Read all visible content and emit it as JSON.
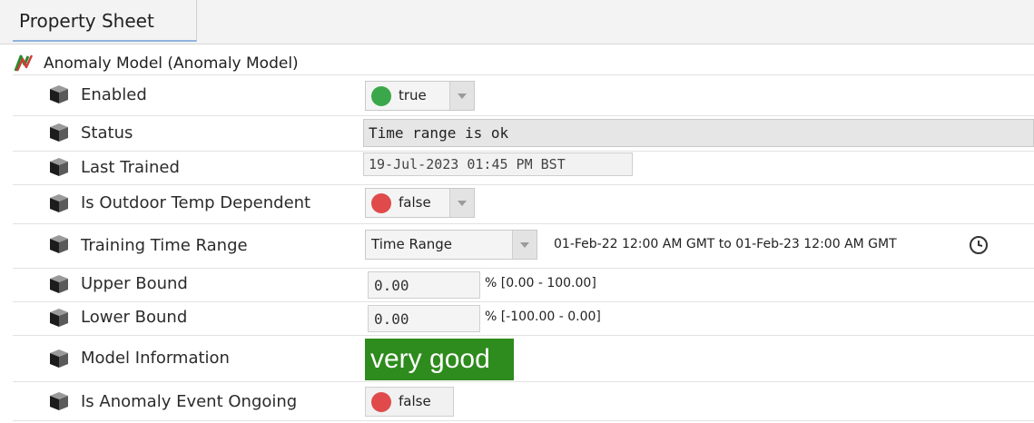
{
  "tab": {
    "title": "Property Sheet"
  },
  "root": {
    "label": "Anomaly Model  (Anomaly Model)",
    "icon": "anomaly-model-icon"
  },
  "properties": [
    {
      "label": "Enabled",
      "value": "true",
      "icon": "property-cube-icon",
      "status_color": "#3aa84a"
    },
    {
      "label": "Status",
      "value": "Time range is ok",
      "icon": "property-cube-icon"
    },
    {
      "label": "Last Trained",
      "value": "19-Jul-2023 01:45 PM BST",
      "icon": "property-cube-icon"
    },
    {
      "label": "Is Outdoor Temp Dependent",
      "value": "false",
      "icon": "property-cube-icon",
      "status_color": "#e04a4a"
    },
    {
      "label": "Training Time Range",
      "value": "Time Range",
      "range_text": "01-Feb-22 12:00 AM GMT to 01-Feb-23 12:00 AM GMT",
      "icon": "property-cube-icon",
      "action_icon": "clock-icon"
    },
    {
      "label": "Upper Bound",
      "value": "0.00",
      "range_note": "% [0.00 - 100.00]",
      "icon": "property-cube-icon"
    },
    {
      "label": "Lower Bound",
      "value": "0.00",
      "range_note": "% [-100.00 - 0.00]",
      "icon": "property-cube-icon"
    },
    {
      "label": "Model Information",
      "value": "very good",
      "icon": "property-cube-icon",
      "badge_color": "#2e8b1d"
    },
    {
      "label": "Is Anomaly Event Ongoing",
      "value": "false",
      "icon": "property-cube-icon",
      "status_color": "#e04a4a"
    }
  ]
}
